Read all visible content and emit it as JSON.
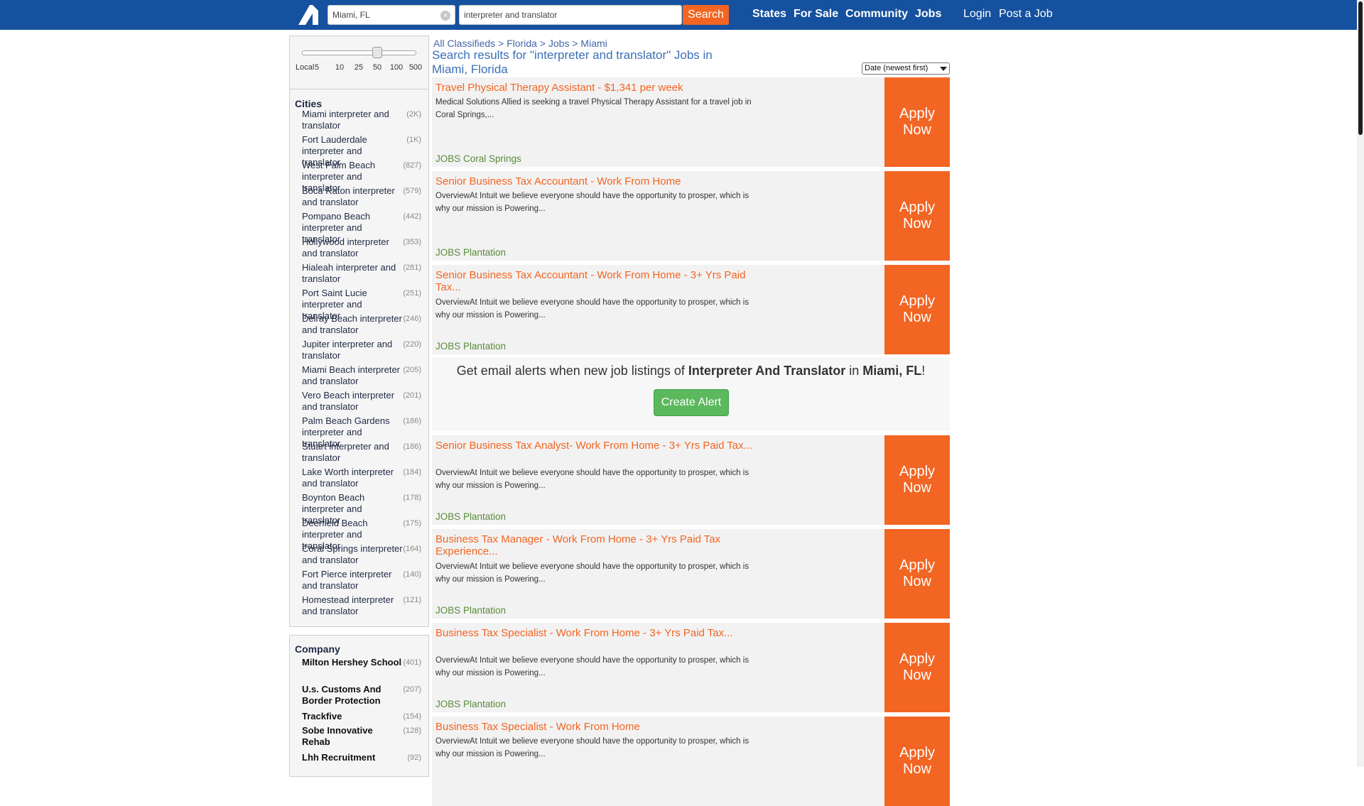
{
  "header": {
    "location_value": "Miami, FL",
    "keyword_value": "interpreter and translator",
    "search_label": "Search",
    "nav": [
      "States",
      "For Sale",
      "Community",
      "Jobs"
    ],
    "login_label": "Login",
    "post_label": "Post a Job",
    "bar_color": "#15519e"
  },
  "distance": {
    "ticks": [
      "Local",
      "5",
      "10",
      "25",
      "50",
      "100",
      "500"
    ],
    "selected": "50"
  },
  "cities": {
    "title": "Cities",
    "items": [
      {
        "label": "Miami interpreter and translator",
        "count": "(2K)"
      },
      {
        "label": "Fort Lauderdale interpreter and translator",
        "count": "(1K)"
      },
      {
        "label": "West Palm Beach interpreter and translator",
        "count": "(827)"
      },
      {
        "label": "Boca Raton interpreter and translator",
        "count": "(579)"
      },
      {
        "label": "Pompano Beach interpreter and translator",
        "count": "(442)"
      },
      {
        "label": "Hollywood interpreter and translator",
        "count": "(353)"
      },
      {
        "label": "Hialeah interpreter and translator",
        "count": "(281)"
      },
      {
        "label": "Port Saint Lucie interpreter and translator",
        "count": "(251)"
      },
      {
        "label": "Delray Beach interpreter and translator",
        "count": "(246)"
      },
      {
        "label": "Jupiter interpreter and translator",
        "count": "(220)"
      },
      {
        "label": "Miami Beach interpreter and translator",
        "count": "(205)"
      },
      {
        "label": "Vero Beach interpreter and translator",
        "count": "(201)"
      },
      {
        "label": "Palm Beach Gardens interpreter and translator",
        "count": "(186)"
      },
      {
        "label": "Stuart interpreter and translator",
        "count": "(186)"
      },
      {
        "label": "Lake Worth interpreter and translator",
        "count": "(184)"
      },
      {
        "label": "Boynton Beach interpreter and translator",
        "count": "(178)"
      },
      {
        "label": "Deerfield Beach interpreter and translator",
        "count": "(175)"
      },
      {
        "label": "Coral Springs interpreter and translator",
        "count": "(164)"
      },
      {
        "label": "Fort Pierce interpreter and translator",
        "count": "(140)"
      },
      {
        "label": "Homestead interpreter and translator",
        "count": "(121)"
      }
    ]
  },
  "company": {
    "title": "Company",
    "items": [
      {
        "label": "Milton Hershey School",
        "count": "(401)"
      },
      {
        "label": "U.s. Customs And Border Protection",
        "count": "(207)"
      },
      {
        "label": "Trackfive",
        "count": "(154)"
      },
      {
        "label": "Sobe Innovative Rehab",
        "count": "(128)"
      },
      {
        "label": "Lhh Recruitment",
        "count": "(92)"
      }
    ]
  },
  "breadcrumb": [
    "All Classifieds",
    ">",
    "Florida",
    ">",
    "Jobs",
    ">",
    "Miami"
  ],
  "results_heading": "Search results for \"interpreter and translator\" Jobs in Miami, Florida",
  "sort_label": "Date (newest first)",
  "apply_label": "Apply Now",
  "jobs": [
    {
      "title": "Travel Physical Therapy Assistant - $1,341 per week",
      "desc": "Medical Solutions Allied is seeking a travel Physical Therapy Assistant for a travel job in Coral Springs,...",
      "location": "JOBS Coral Springs"
    },
    {
      "title": "Senior Business Tax Accountant - Work From Home",
      "desc": "OverviewAt Intuit we believe everyone should have the opportunity to prosper, which is why our mission is Powering...",
      "location": "JOBS Plantation"
    },
    {
      "title": "Senior Business Tax Accountant - Work From Home - 3+ Yrs Paid Tax...",
      "desc": "OverviewAt Intuit we believe everyone should have the opportunity to prosper, which is why our mission is Powering...",
      "location": "JOBS Plantation"
    },
    {
      "title": "Senior Business Tax Analyst- Work From Home - 3+ Yrs Paid Tax...",
      "desc": "OverviewAt Intuit we believe everyone should have the opportunity to prosper, which is why our mission is Powering...",
      "location": "JOBS Plantation"
    },
    {
      "title": "Business Tax Manager - Work From Home - 3+ Yrs Paid Tax Experience...",
      "desc": "OverviewAt Intuit we believe everyone should have the opportunity to prosper, which is why our mission is Powering...",
      "location": "JOBS Plantation"
    },
    {
      "title": "Business Tax Specialist - Work From Home - 3+ Yrs Paid Tax...",
      "desc": "OverviewAt Intuit we believe everyone should have the opportunity to prosper, which is why our mission is Powering...",
      "location": "JOBS Plantation"
    },
    {
      "title": "Business Tax Specialist - Work From Home",
      "desc": "OverviewAt Intuit we believe everyone should have the opportunity to prosper, which is why our mission is Powering...",
      "location": ""
    }
  ],
  "alert": {
    "prefix": "Get email alerts when new job listings of ",
    "keyword": "Interpreter And Translator",
    "middle": " in ",
    "place": "Miami, FL",
    "suffix": "!",
    "button_label": "Create Alert"
  },
  "colors": {
    "accent": "#f26522",
    "location_green": "#5b8b3a",
    "link_blue": "#3a6fb6"
  }
}
